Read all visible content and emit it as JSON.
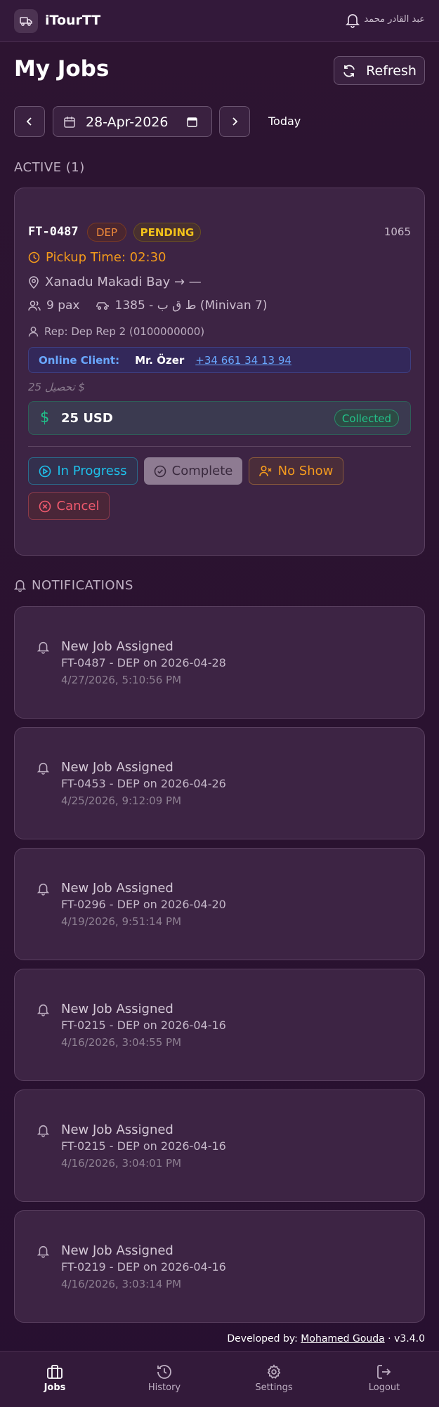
{
  "header": {
    "app_name": "iTourTT",
    "user_name": "عبد القادر محمد"
  },
  "page": {
    "title": "My Jobs",
    "refresh_label": "Refresh",
    "date_value": "28-Apr-2026",
    "today_label": "Today"
  },
  "active": {
    "section_label": "ACTIVE (1)"
  },
  "job": {
    "id": "FT-0487",
    "type_badge": "DEP",
    "status_badge": "PENDING",
    "number": "1065",
    "pickup": "Pickup Time: 02:30",
    "route": "Xanadu Makadi Bay → —",
    "pax": "9 pax",
    "vehicle": "ط ق ب - 1385 (Minivan 7)",
    "rep": "Rep: Dep Rep 2 (0100000000)",
    "client_label": "Online Client:",
    "client_name": "Mr. Özer",
    "client_phone": "+34 661 34 13 94",
    "collect_note": "تحصيل 25 $",
    "payment_symbol": "$",
    "payment_amount": "25 USD",
    "payment_status": "Collected",
    "actions": {
      "in_progress": "In Progress",
      "complete": "Complete",
      "no_show": "No Show",
      "cancel": "Cancel"
    }
  },
  "notifications": {
    "header": "NOTIFICATIONS",
    "items": [
      {
        "title": "New Job Assigned",
        "detail": "FT-0487 - DEP on 2026-04-28",
        "time": "4/27/2026, 5:10:56 PM"
      },
      {
        "title": "New Job Assigned",
        "detail": "FT-0453 - DEP on 2026-04-26",
        "time": "4/25/2026, 9:12:09 PM"
      },
      {
        "title": "New Job Assigned",
        "detail": "FT-0296 - DEP on 2026-04-20",
        "time": "4/19/2026, 9:51:14 PM"
      },
      {
        "title": "New Job Assigned",
        "detail": "FT-0215 - DEP on 2026-04-16",
        "time": "4/16/2026, 3:04:55 PM"
      },
      {
        "title": "New Job Assigned",
        "detail": "FT-0215 - DEP on 2026-04-16",
        "time": "4/16/2026, 3:04:01 PM"
      },
      {
        "title": "New Job Assigned",
        "detail": "FT-0219 - DEP on 2026-04-16",
        "time": "4/16/2026, 3:03:14 PM"
      }
    ]
  },
  "footer": {
    "prefix": "Developed by: ",
    "developer": "Mohamed Gouda",
    "version": " · v3.4.0"
  },
  "bottom_nav": {
    "jobs": "Jobs",
    "history": "History",
    "settings": "Settings",
    "logout": "Logout"
  },
  "colors": {
    "background": "#2c1430",
    "accent_orange": "#f39a1b",
    "accent_cyan": "#1ec0ea",
    "accent_green": "#20c08a",
    "accent_red": "#f05a6e",
    "accent_blue": "#6aa8ff"
  }
}
